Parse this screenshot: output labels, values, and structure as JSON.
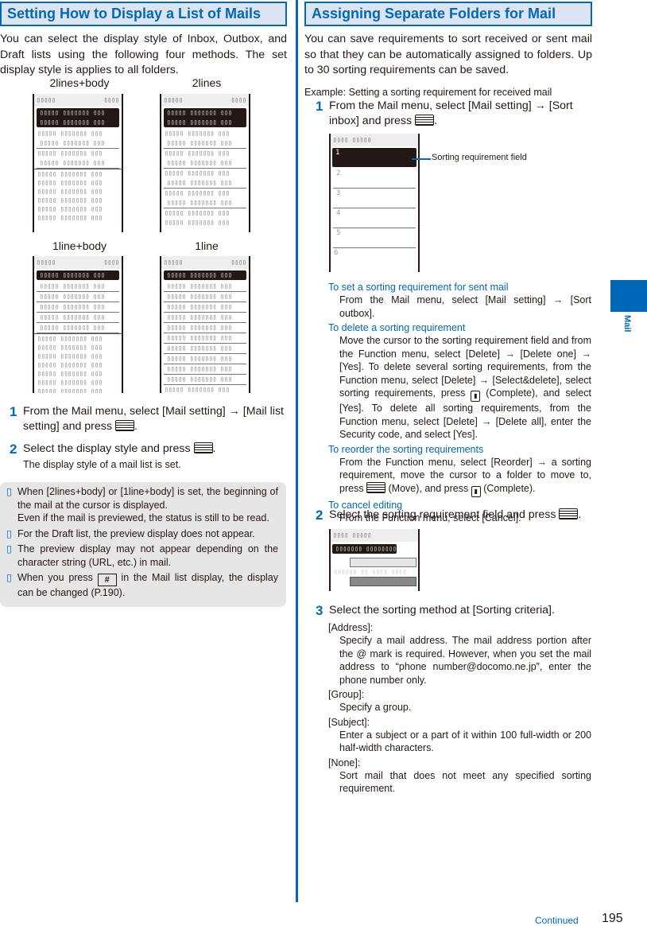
{
  "left": {
    "title": "Setting How to Display a List of Mails",
    "intro": "You can select the display style of Inbox, Outbox, and Draft lists using the following four methods. The set display style is applies to all folders.",
    "screens": [
      {
        "label": "2lines+body"
      },
      {
        "label": "2lines"
      },
      {
        "label": "1line+body"
      },
      {
        "label": "1line"
      }
    ],
    "steps": [
      {
        "num": "1",
        "text_a": "From the Mail menu, select [Mail setting] → [Mail list setting] and press ",
        "text_b": "."
      },
      {
        "num": "2",
        "text_a": "Select the display style and press ",
        "text_b": ".",
        "sub": "The display style of a mail list is set."
      }
    ],
    "notes": [
      "When [2lines+body] or [1line+body] is set, the beginning of the mail at the cursor is displayed.\nEven if the mail is previewed, the status is still to be read.",
      "For the Draft list, the preview display does not appear.",
      "The preview display may not appear depending on the character string (URL, etc.) in mail."
    ],
    "note_key": {
      "text_a": "When you press ",
      "key": "#",
      "text_b": " in the Mail list display, the display can be changed (P.190)."
    },
    "note_bullet": "▯"
  },
  "right": {
    "title": "Assigning Separate Folders for Mail",
    "intro": "You can save requirements to sort received or sent mail so that they can be automatically assigned to folders. Up to 30 sorting requirements can be saved.",
    "example": "Example: Setting a sorting requirement for received mail",
    "step1": {
      "num": "1",
      "text_a": "From the Mail menu, select [Mail setting] → [Sort inbox] and press ",
      "text_b": "."
    },
    "callout": "Sorting requirement field",
    "sort_fields": [
      "1",
      "2",
      "3",
      "4",
      "5",
      "6"
    ],
    "subs": [
      {
        "heading": "To set a sorting requirement for sent mail",
        "body": "From the Mail menu, select [Mail setting] → [Sort outbox]."
      },
      {
        "heading": "To delete a sorting requirement",
        "body_a": "Move the cursor to the sorting requirement field and from the Function menu, select [Delete] → [Delete one] → [Yes]. To delete several sorting requirements, from the Function menu, select [Delete] → [Select&delete], select sorting requirements, press ",
        "body_b": " (Complete), and select [Yes]. To delete all sorting requirements, from the Function menu, select [Delete] → [Delete all], enter the Security code, and select [Yes]."
      },
      {
        "heading": "To reorder the sorting requirements",
        "body_a": "From the Function menu, select [Reorder] → a sorting requirement, move the cursor to a folder to move to, press ",
        "body_b": " (Move), and press ",
        "body_c": " (Complete)."
      },
      {
        "heading": "To cancel editing",
        "body": "From the Function menu, select [Cancel]."
      }
    ],
    "step2": {
      "num": "2",
      "text_a": "Select the sorting requirement field and press ",
      "text_b": "."
    },
    "step3": {
      "num": "3",
      "text": "Select the sorting method at [Sorting criteria]."
    },
    "criteria": [
      {
        "name": "[Address]:",
        "desc": "Specify a mail address. The mail address portion after the @ mark is required. However, when you set the mail address to “phone number@docomo.ne.jp”, enter the phone number only."
      },
      {
        "name": "[Group]:",
        "desc": "Specify a group."
      },
      {
        "name": "[Subject]:",
        "desc": "Enter a subject or a part of it within 100 full-width or 200 half-width characters."
      },
      {
        "name": "[None]:",
        "desc": "Sort mail that does not meet any specified sorting requirement."
      }
    ]
  },
  "side_tab": "Mail",
  "footer": {
    "continued": "Continued",
    "page": "195"
  },
  "placeholder_text": {
    "bar_left": "▯▯▯▯▯",
    "bar_right": "▯▯▯▯",
    "line": "▯▯▯▯▯ ▯▯▯▯▯▯▯ ▯▯▯",
    "sort_bar": "▯▯▯▯ ▯▯▯▯▯",
    "sort_sel": "▯▯▯▯▯▯▯ ▯▯▯▯▯▯▯▯",
    "sort_sub": "▯▯▯▯▯▯ ▯▯ ▯▯▯▯ ▯▯▯▯"
  }
}
